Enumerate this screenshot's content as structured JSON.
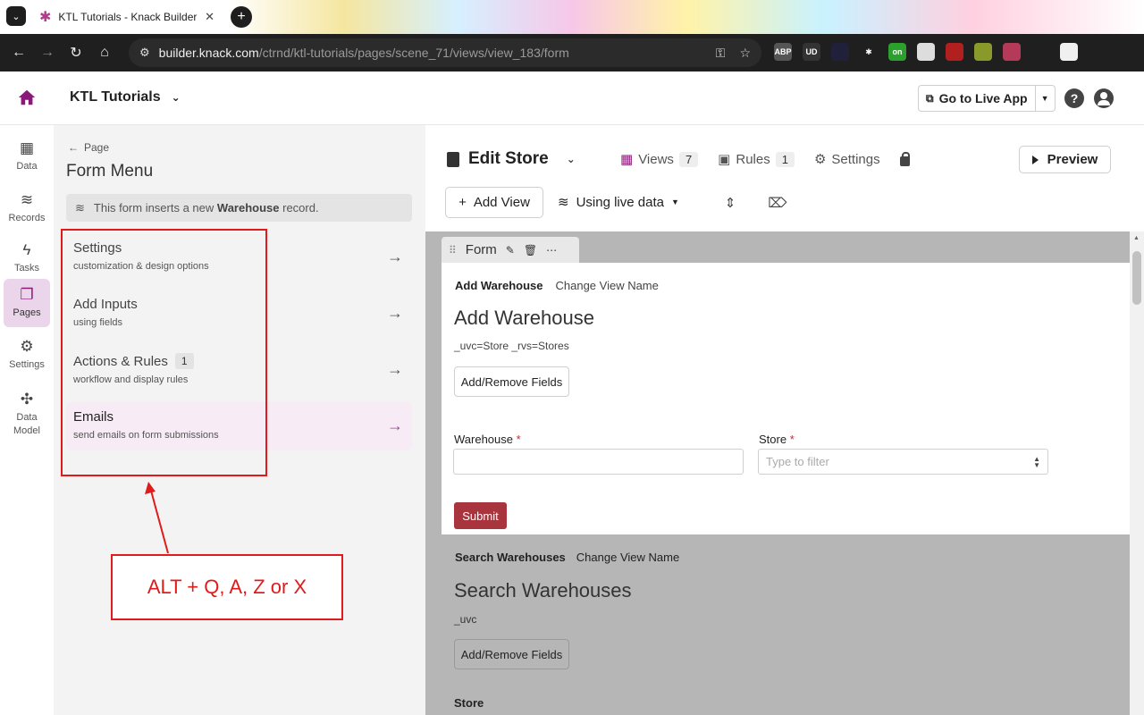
{
  "browser": {
    "tab_title": "KTL Tutorials - Knack Builder",
    "tab_close": "✕",
    "new_tab": "+",
    "url_host": "builder.knack.com",
    "url_path": "/ctrnd/ktl-tutorials/pages/scene_71/views/view_183/form",
    "extensions": [
      {
        "name": "adblock-icon",
        "label": "ABP",
        "color": "#555555"
      },
      {
        "name": "ublock-icon",
        "label": "UD",
        "color": "#333333"
      },
      {
        "name": "ext-dark-icon",
        "label": "",
        "color": "#20203a"
      },
      {
        "name": "ext-green-star-icon",
        "label": "✱",
        "color": "#1f1f1f"
      },
      {
        "name": "ext-on-icon",
        "label": "on",
        "color": "#2ca02c"
      },
      {
        "name": "ext-window-icon",
        "label": "",
        "color": "#dddddd"
      },
      {
        "name": "ext-red-icon",
        "label": "",
        "color": "#b21f1f"
      },
      {
        "name": "ext-yellow-icon",
        "label": "",
        "color": "#8a9a2a"
      },
      {
        "name": "ext-redblue-icon",
        "label": "",
        "color": "#b53a5a"
      },
      {
        "name": "extensions-puzzle-icon",
        "label": "",
        "color": "#1f1f1f"
      },
      {
        "name": "profile-avatar-icon",
        "label": "",
        "color": "#f0f0f0"
      }
    ]
  },
  "app": {
    "name": "KTL Tutorials",
    "live_app_label": "Go to Live App",
    "help": "?"
  },
  "rail": [
    {
      "name": "data",
      "label": "Data",
      "icon": "▦"
    },
    {
      "name": "records",
      "label": "Records",
      "icon": "≋"
    },
    {
      "name": "tasks",
      "label": "Tasks",
      "icon": "ϟ"
    },
    {
      "name": "pages",
      "label": "Pages",
      "icon": "❐",
      "active": true
    },
    {
      "name": "settings",
      "label": "Settings",
      "icon": "⚙"
    },
    {
      "name": "data-model",
      "label": "Data Model",
      "icon": "✣"
    }
  ],
  "menu": {
    "back_label": "Page",
    "title": "Form Menu",
    "info_prefix": "This form inserts a new ",
    "info_object": "Warehouse",
    "info_suffix": " record.",
    "items": [
      {
        "title": "Settings",
        "sub": "customization & design options",
        "badge": ""
      },
      {
        "title": "Add Inputs",
        "sub": "using fields",
        "badge": ""
      },
      {
        "title": "Actions & Rules",
        "sub": "workflow and display rules",
        "badge": "1"
      },
      {
        "title": "Emails",
        "sub": "send emails on form submissions",
        "badge": ""
      }
    ]
  },
  "annotation": {
    "callout_text": "ALT + Q, A, Z or X",
    "color": "#e01b1b"
  },
  "editor": {
    "page_title": "Edit Store",
    "tabs": [
      {
        "label": "Views",
        "count": "7"
      },
      {
        "label": "Rules",
        "count": "1"
      },
      {
        "label": "Settings",
        "count": ""
      }
    ],
    "preview_label": "Preview",
    "add_view_label": "Add View",
    "live_data_label": "Using live data"
  },
  "form_view": {
    "tab_label": "Form",
    "view_name": "Add Warehouse",
    "rename_label": "Change View Name",
    "title": "Add Warehouse",
    "description": "_uvc=Store _rvs=Stores",
    "add_fields_label": "Add/Remove Fields",
    "fields": [
      {
        "label": "Warehouse",
        "required": "*",
        "placeholder": ""
      },
      {
        "label": "Store",
        "required": "*",
        "placeholder": "Type to filter"
      }
    ],
    "submit_label": "Submit",
    "submit_color": "#a8343e"
  },
  "search_view": {
    "view_name": "Search Warehouses",
    "rename_label": "Change View Name",
    "title": "Search Warehouses",
    "description": "_uvc",
    "add_fields_label": "Add/Remove Fields",
    "field_label": "Store"
  },
  "colors": {
    "brand": "#8a1a77",
    "highlight": "#f7ebf5"
  }
}
